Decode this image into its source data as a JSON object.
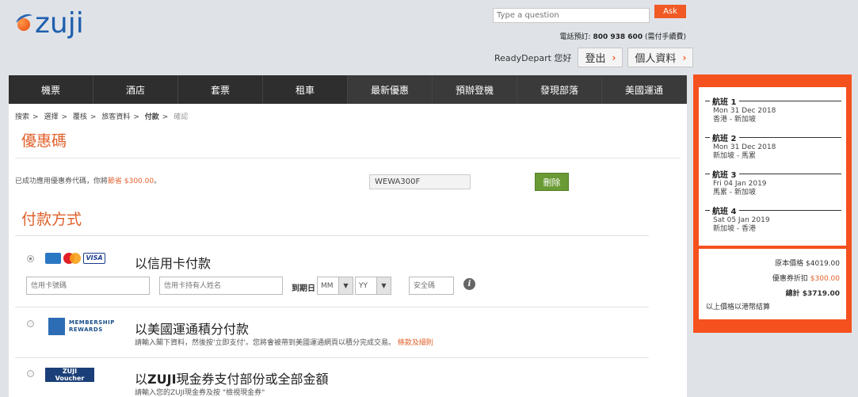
{
  "header": {
    "logo_text": "zuji",
    "ask_placeholder": "Type a question",
    "ask_label": "Ask",
    "phone_label": "電話預訂:",
    "phone_number": "800 938 600",
    "phone_note": "(需付手續費)",
    "user_greeting": "ReadyDepart 您好",
    "logout_label": "登出",
    "profile_label": "個人資料"
  },
  "nav": {
    "items": [
      "機票",
      "酒店",
      "套票",
      "租車",
      "最新優惠",
      "預辦登機",
      "發現部落",
      "美國運通"
    ]
  },
  "breadcrumb": {
    "items": [
      "搜索",
      "選擇",
      "覆核",
      "旅客資料",
      "付款",
      "確認"
    ],
    "separator": ">"
  },
  "coupon": {
    "heading": "優惠碼",
    "applied_text": "已成功應用優惠券代碼，你將",
    "save_text": "節省 $300.00",
    "applied_suffix": "。",
    "code": "WEWA300F",
    "delete_label": "刪除"
  },
  "payment": {
    "heading": "付款方式",
    "credit": {
      "title": "以信用卡付款",
      "card_number_placeholder": "信用卡號碼",
      "holder_placeholder": "信用卡持有人姓名",
      "expiry_label": "到期日",
      "month_value": "MM",
      "year_value": "YY",
      "cvv_placeholder": "安全碼",
      "visa_text": "VISA"
    },
    "amex": {
      "title": "以美國運通積分付款",
      "logo_line1": "MEMBERSHIP",
      "logo_line2": "REWARDS",
      "desc": "請輸入閣下資料，然後按'立即支付'。您將會被帶到美國運通網頁以積分完成交易。",
      "link": "條款及細則"
    },
    "voucher": {
      "title_prefix": "以",
      "title_brand": "ZUJI",
      "title_suffix": "現金券支付部份或全部金額",
      "logo_line1": "ZUJI",
      "logo_line2": "Voucher",
      "desc": "請輸入您的ZUJI現金券及按 \"檢視現金券\""
    }
  },
  "sidebar": {
    "flights": [
      {
        "title": "航班 1",
        "date": "Mon 31 Dec 2018",
        "route": "香港 - 新加坡"
      },
      {
        "title": "航班 2",
        "date": "Mon 31 Dec 2018",
        "route": "新加坡 - 馬累"
      },
      {
        "title": "航班 3",
        "date": "Fri 04 Jan 2019",
        "route": "馬累 - 新加坡"
      },
      {
        "title": "航班 4",
        "date": "Sat 05 Jan 2019",
        "route": "新加坡 - 香港"
      }
    ],
    "original_label": "原本價格",
    "original_value": "$4019.00",
    "discount_label": "優惠券折扣",
    "discount_value": "$300.00",
    "total_label": "總計",
    "total_value": "$3719.00",
    "note": "以上價格以港幣結算"
  },
  "colors": {
    "accent": "#f15a24",
    "brand_blue": "#1f5fae",
    "delete_green": "#6a9a33",
    "nav_bg": "#2e2e2e"
  }
}
